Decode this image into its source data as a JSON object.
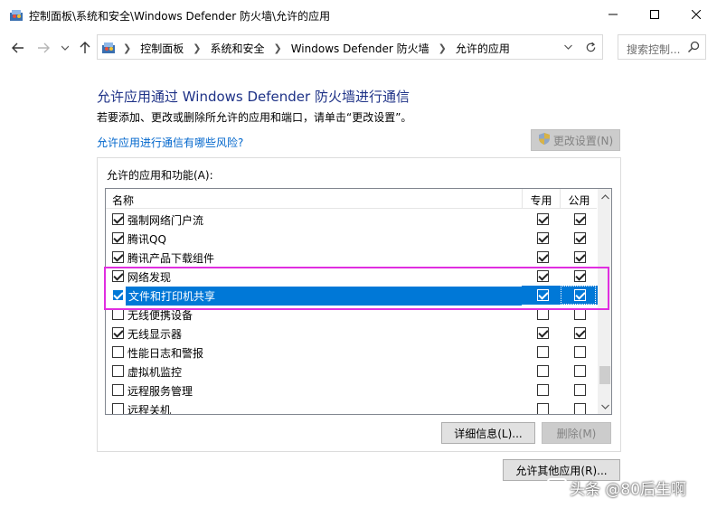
{
  "window": {
    "title": "控制面板\\系统和安全\\Windows Defender 防火墙\\允许的应用",
    "minimize_label": "—",
    "maximize_label": "☐",
    "close_label": "✕"
  },
  "nav": {
    "breadcrumbs": [
      "控制面板",
      "系统和安全",
      "Windows Defender 防火墙",
      "允许的应用"
    ],
    "search_placeholder": "搜索控制..."
  },
  "main": {
    "heading": "允许应用通过 Windows Defender 防火墙进行通信",
    "description": "若要添加、更改或删除所允许的应用和端口，请单击“更改设置”。",
    "risk_link": "允许应用进行通信有哪些风险?",
    "change_settings_label": "更改设置(N)"
  },
  "apps": {
    "group_label": "允许的应用和功能(A):",
    "columns": {
      "name": "名称",
      "private": "专用",
      "public": "公用"
    },
    "rows": [
      {
        "name": "强制网络门户流",
        "enabled": true,
        "private": true,
        "public": true
      },
      {
        "name": "腾讯QQ",
        "enabled": true,
        "private": true,
        "public": true
      },
      {
        "name": "腾讯产品下载组件",
        "enabled": true,
        "private": true,
        "public": true
      },
      {
        "name": "网络发现",
        "enabled": true,
        "private": true,
        "public": true
      },
      {
        "name": "文件和打印机共享",
        "enabled": true,
        "private": true,
        "public": true,
        "selected": true
      },
      {
        "name": "无线便携设备",
        "enabled": false,
        "private": false,
        "public": false
      },
      {
        "name": "无线显示器",
        "enabled": true,
        "private": true,
        "public": true
      },
      {
        "name": "性能日志和警报",
        "enabled": false,
        "private": false,
        "public": false
      },
      {
        "name": "虚拟机监控",
        "enabled": false,
        "private": false,
        "public": false
      },
      {
        "name": "远程服务管理",
        "enabled": false,
        "private": false,
        "public": false
      },
      {
        "name": "远程关机",
        "enabled": false,
        "private": false,
        "public": false
      }
    ],
    "details_label": "详细信息(L)...",
    "remove_label": "删除(M)",
    "allow_other_label": "允许其他应用(R)..."
  },
  "watermark": "头条 @80后生啊",
  "colors": {
    "heading": "#1e3287",
    "link": "#0066cc",
    "selection": "#0078d7",
    "highlight_box": "#e02ee0"
  }
}
